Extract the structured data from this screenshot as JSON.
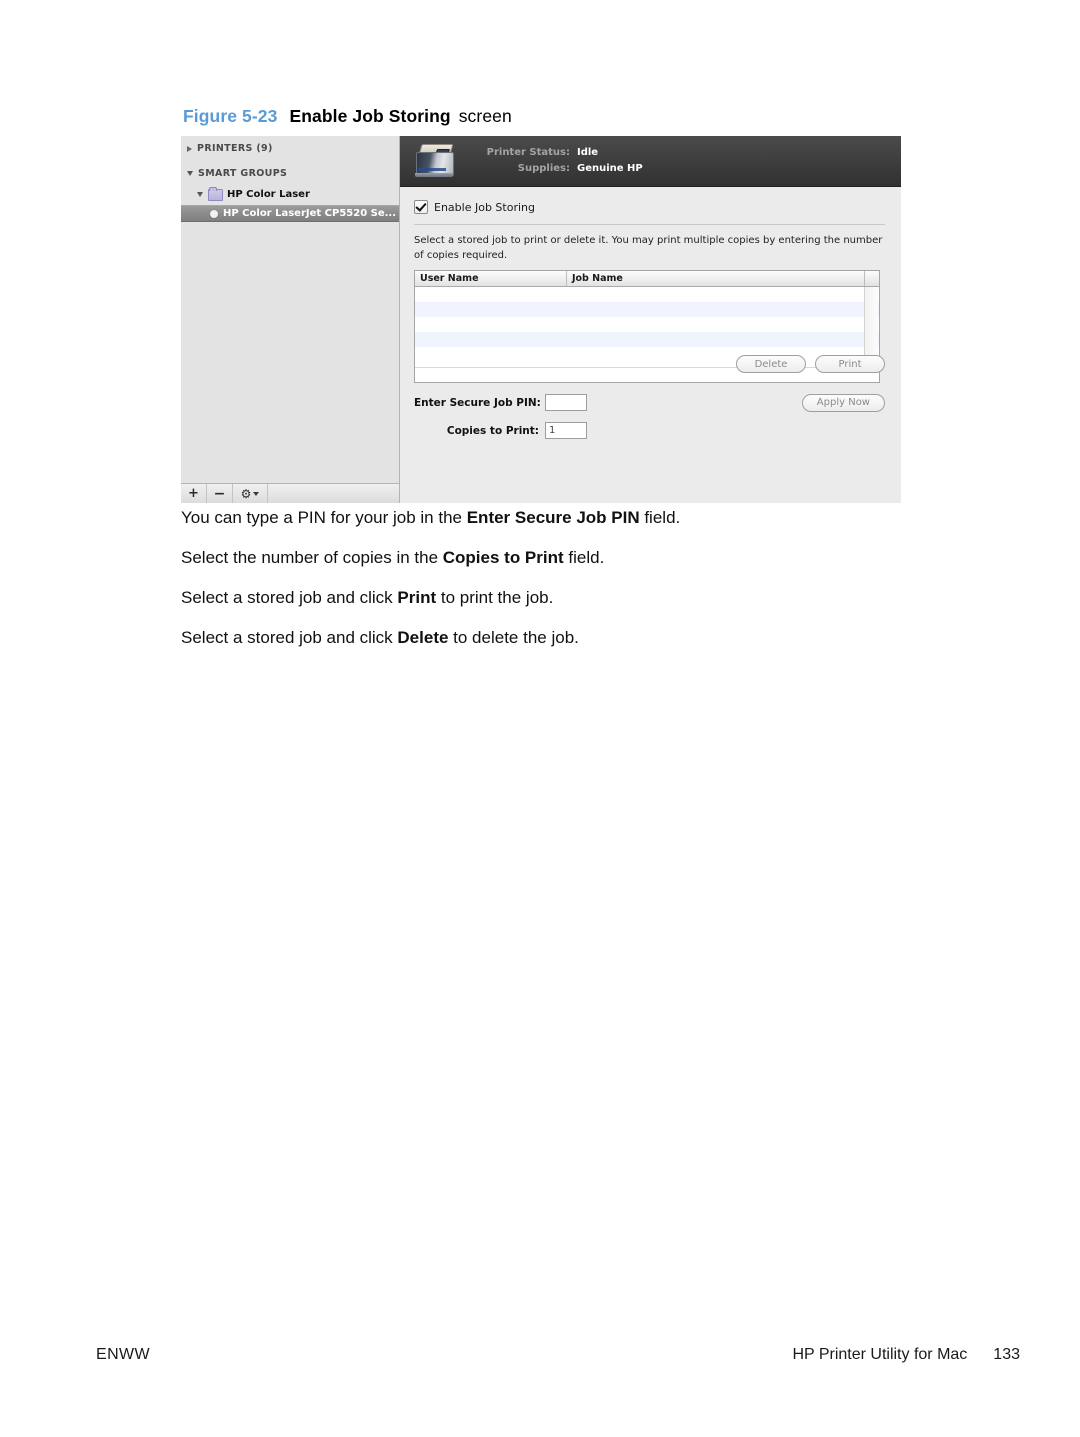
{
  "figure": {
    "label": "Figure",
    "number": "5-23",
    "title": "Enable Job Storing",
    "tail": "screen"
  },
  "screenshot": {
    "sidebar": {
      "groups": [
        {
          "label": "PRINTERS (9)",
          "expanded": false
        },
        {
          "label": "SMART GROUPS",
          "expanded": true
        }
      ],
      "folder": {
        "label": "HP Color Laser"
      },
      "selected_item": {
        "label": "HP Color LaserJet CP5520 Se..."
      },
      "toolbar": {
        "add": "+",
        "remove": "−",
        "gear": "⚙"
      }
    },
    "status_bar": {
      "rows": [
        {
          "label": "Printer Status:",
          "value": "Idle"
        },
        {
          "label": "Supplies:",
          "value": "Genuine HP"
        }
      ]
    },
    "pane": {
      "checkbox": {
        "label": "Enable Job Storing",
        "checked": true
      },
      "description": "Select a stored job to print or delete it.  You may print multiple copies by entering the number of copies required.",
      "table": {
        "columns": [
          "User Name",
          "Job Name",
          ""
        ],
        "rows": [
          [],
          [],
          [],
          [],
          []
        ]
      },
      "fields": [
        {
          "label": "Enter Secure Job PIN:",
          "value": "",
          "placeholder": ""
        },
        {
          "label": "Copies to Print:",
          "value": "1",
          "placeholder": ""
        }
      ],
      "buttons": {
        "delete": "Delete",
        "print": "Print",
        "apply": "Apply Now"
      }
    }
  },
  "body": {
    "paragraphs": [
      {
        "pre": "You can type a PIN for your job in the ",
        "bold": "Enter Secure Job PIN",
        "post": " field."
      },
      {
        "pre": "Select the number of copies in the ",
        "bold": "Copies to Print",
        "post": " field."
      },
      {
        "pre": "Select a stored job and click ",
        "bold": "Print",
        "post": " to print the job."
      },
      {
        "pre": "Select a stored job and click ",
        "bold": "Delete",
        "post": " to delete the job."
      }
    ]
  },
  "footer": {
    "left": "ENWW",
    "right": "HP Printer Utility for Mac",
    "page": "133"
  },
  "colors": {
    "figure_accent": "#5b9bd5",
    "status_bar_dark": "#3a3a3a",
    "selection_gray": "#8c8c8c",
    "row_alt_blue": "#eff4fd"
  }
}
